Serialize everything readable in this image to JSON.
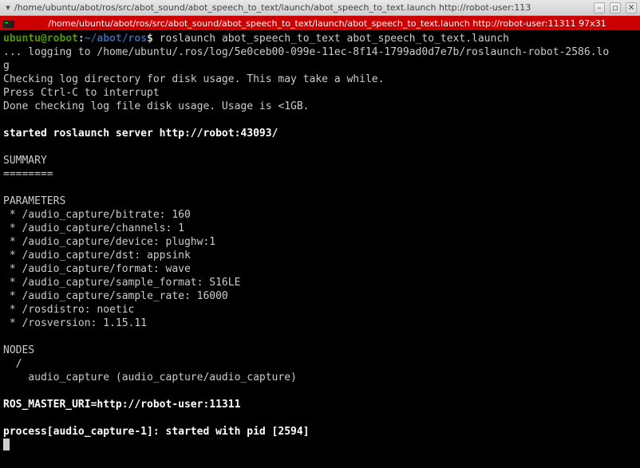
{
  "window": {
    "title": "/home/ubuntu/abot/ros/src/abot_sound/abot_speech_to_text/launch/abot_speech_to_text.launch http://robot-user:113"
  },
  "tab": {
    "label": "/home/ubuntu/abot/ros/src/abot_sound/abot_speech_to_text/launch/abot_speech_to_text.launch http://robot-user:11311 97x31"
  },
  "prompt": {
    "user_host": "ubuntu@robot",
    "colon": ":",
    "path": "~/abot/ros",
    "dollar": "$",
    "command": " roslaunch abot_speech_to_text abot_speech_to_text.launch"
  },
  "lines": {
    "l1": "... logging to /home/ubuntu/.ros/log/5e0ceb00-099e-11ec-8f14-1799ad0d7e7b/roslaunch-robot-2586.lo",
    "l2": "g",
    "l3": "Checking log directory for disk usage. This may take a while.",
    "l4": "Press Ctrl-C to interrupt",
    "l5": "Done checking log file disk usage. Usage is <1GB.",
    "l6": "",
    "l7": "started roslaunch server http://robot:43093/",
    "l8": "",
    "l9": "SUMMARY",
    "l10": "========",
    "l11": "",
    "l12": "PARAMETERS",
    "l13": " * /audio_capture/bitrate: 160",
    "l14": " * /audio_capture/channels: 1",
    "l15": " * /audio_capture/device: plughw:1",
    "l16": " * /audio_capture/dst: appsink",
    "l17": " * /audio_capture/format: wave",
    "l18": " * /audio_capture/sample_format: S16LE",
    "l19": " * /audio_capture/sample_rate: 16000",
    "l20": " * /rosdistro: noetic",
    "l21": " * /rosversion: 1.15.11",
    "l22": "",
    "l23": "NODES",
    "l24": "  /",
    "l25": "    audio_capture (audio_capture/audio_capture)",
    "l26": "",
    "l27": "ROS_MASTER_URI=http://robot-user:11311",
    "l28": "",
    "l29": "process[audio_capture-1]: started with pid [2594]"
  }
}
